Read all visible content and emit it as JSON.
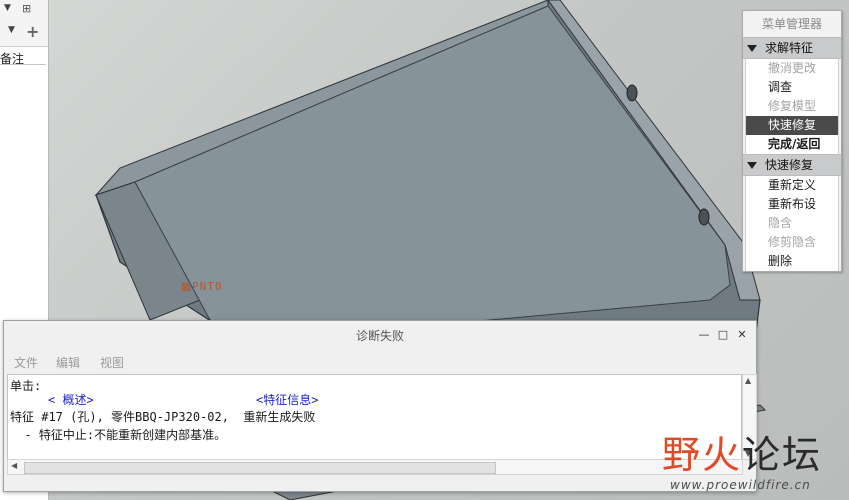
{
  "left_panel": {
    "label": "备注"
  },
  "model": {
    "point_label": "PNT0"
  },
  "menu_manager": {
    "title": "菜单管理器",
    "sections": [
      {
        "header": "求解特征",
        "items": [
          {
            "label": "撤消更改",
            "enabled": false
          },
          {
            "label": "调查",
            "enabled": true
          },
          {
            "label": "修复模型",
            "enabled": false
          },
          {
            "label": "快速修复",
            "enabled": true,
            "selected": true
          },
          {
            "label": "完成/返回",
            "enabled": true,
            "bold": true
          }
        ]
      },
      {
        "header": "快速修复",
        "items": [
          {
            "label": "重新定义",
            "enabled": true
          },
          {
            "label": "重新布设",
            "enabled": true
          },
          {
            "label": "隐含",
            "enabled": false
          },
          {
            "label": "修剪隐含",
            "enabled": false
          },
          {
            "label": "删除",
            "enabled": true
          }
        ]
      }
    ]
  },
  "dialog": {
    "title": "诊断失败",
    "menus": [
      "文件",
      "编辑",
      "视图"
    ],
    "click_label": "单击:",
    "link_overview": "< 概述>",
    "link_feature_info": "<特征信息>",
    "line_feature": "特征 #17 (孔), 零件BBQ-JP320-02,  重新生成失败",
    "line_detail": "  - 特征中止:不能重新创建内部基准。"
  },
  "watermark": {
    "text_left": "野火",
    "text_right": "论坛",
    "url": "www.proewildfire.cn"
  }
}
